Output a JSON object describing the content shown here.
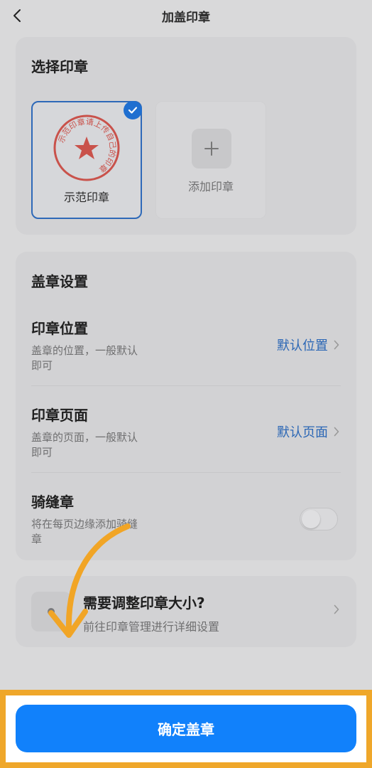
{
  "header": {
    "title": "加盖印章",
    "back_icon": "chevron-left-icon"
  },
  "seal_select": {
    "title": "选择印章",
    "seals": [
      {
        "label": "示范印章",
        "selected": true,
        "ring_text": "示范印章请上传自己的印章"
      }
    ],
    "add_label": "添加印章"
  },
  "settings": {
    "title": "盖章设置",
    "position": {
      "title": "印章位置",
      "desc": "盖章的位置，一般默认即可",
      "value": "默认位置"
    },
    "page": {
      "title": "印章页面",
      "desc": "盖章的页面，一般默认即可",
      "value": "默认页面"
    },
    "cross": {
      "title": "骑缝章",
      "desc": "将在每页边缘添加骑缝章",
      "toggle_on": false
    }
  },
  "tip": {
    "title": "需要调整印章大小?",
    "subtitle": "前往印章管理进行详细设置"
  },
  "confirm_label": "确定盖章",
  "colors": {
    "accent": "#1181fb",
    "link": "#2a66b5",
    "highlight": "#efa72a",
    "seal_red": "#d94b45"
  }
}
